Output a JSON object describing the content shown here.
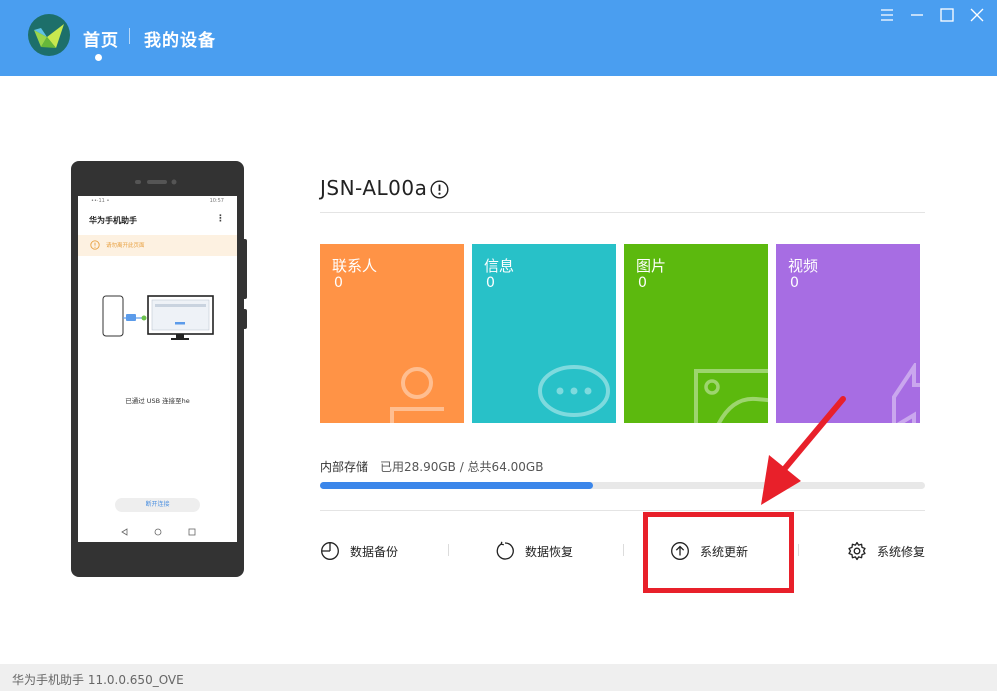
{
  "header": {
    "nav_home": "首页",
    "nav_devices": "我的设备",
    "window_controls": [
      "menu-icon",
      "minimize-icon",
      "maximize-icon",
      "close-icon"
    ],
    "bg_color": "#4a9ef0"
  },
  "phone": {
    "status_left": "••·11 •",
    "status_time": "10:57",
    "app_title": "华为手机助手",
    "menu_glyph": "⋮",
    "notice": "请勿离开此页面",
    "usb_status": "已通过 USB 连接至he",
    "disconnect_label": "断开连接"
  },
  "device": {
    "name": "JSN-AL00a"
  },
  "tiles": [
    {
      "label": "联系人",
      "count": "0",
      "color": "#ff9346",
      "icon": "contact-icon"
    },
    {
      "label": "信息",
      "count": "0",
      "color": "#28c1c8",
      "icon": "message-icon"
    },
    {
      "label": "图片",
      "count": "0",
      "color": "#5cb90e",
      "icon": "image-icon"
    },
    {
      "label": "视频",
      "count": "0",
      "color": "#a76de3",
      "icon": "video-icon"
    }
  ],
  "storage": {
    "label": "内部存储",
    "value": "已用28.90GB / 总共64.00GB",
    "used_fraction": 0.4516,
    "bar_color": "#3b86ea"
  },
  "actions": [
    {
      "label": "数据备份",
      "icon": "backup-icon"
    },
    {
      "label": "数据恢复",
      "icon": "restore-icon"
    },
    {
      "label": "系统更新",
      "icon": "update-icon"
    },
    {
      "label": "系统修复",
      "icon": "gear-icon"
    }
  ],
  "annotation": {
    "color": "#e8202a"
  },
  "footer": {
    "version_text": "华为手机助手 11.0.0.650_OVE"
  }
}
